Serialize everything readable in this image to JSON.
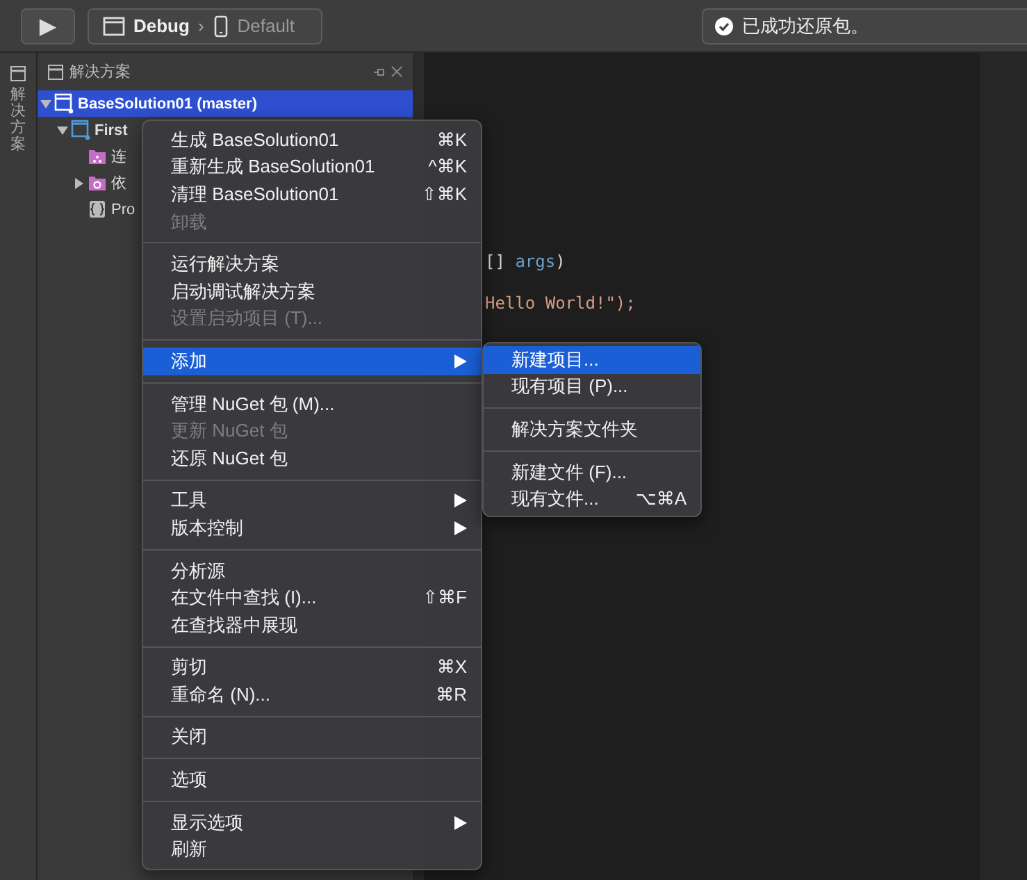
{
  "toolbar": {
    "run_button": {
      "label": "▶"
    },
    "configuration": "Debug",
    "separator": "›",
    "device": "Default",
    "status": "已成功还原包。"
  },
  "side_tab": {
    "label": "解决方案"
  },
  "solution_panel": {
    "title": "解决方案",
    "tree": [
      {
        "label": "BaseSolution01 (master)",
        "selected": true,
        "expanded": true,
        "kind": "solution",
        "children": [
          {
            "label": "First",
            "selected": false,
            "expanded": true,
            "kind": "project",
            "children": [
              {
                "label": "连",
                "selected": false,
                "kind": "folder"
              },
              {
                "label": "依",
                "selected": false,
                "expanded": false,
                "kind": "package-folder"
              },
              {
                "label": "Pro",
                "selected": false,
                "kind": "code-file"
              }
            ]
          }
        ]
      }
    ]
  },
  "editor": {
    "code_lines": [
      {
        "text": "[] ",
        "arg": "args",
        "tail": ")"
      },
      {
        "text": "Hello World!\");"
      }
    ]
  },
  "context_menu": {
    "items": [
      {
        "kind": "item",
        "label": "生成 BaseSolution01",
        "shortcut": "⌘K",
        "disabled": false,
        "selected": false,
        "submenu": false
      },
      {
        "kind": "item",
        "label": "重新生成 BaseSolution01",
        "shortcut": "^⌘K",
        "disabled": false,
        "selected": false,
        "submenu": false
      },
      {
        "kind": "item",
        "label": "清理 BaseSolution01",
        "shortcut": "⇧⌘K",
        "disabled": false,
        "selected": false,
        "submenu": false
      },
      {
        "kind": "item",
        "label": "卸载",
        "disabled": true,
        "selected": false,
        "submenu": false
      },
      {
        "kind": "separator"
      },
      {
        "kind": "item",
        "label": "运行解决方案",
        "disabled": false,
        "selected": false,
        "submenu": false
      },
      {
        "kind": "item",
        "label": "启动调试解决方案",
        "disabled": false,
        "selected": false,
        "submenu": false
      },
      {
        "kind": "item",
        "label": "设置启动项目 (T)...",
        "disabled": true,
        "selected": false,
        "submenu": false
      },
      {
        "kind": "separator"
      },
      {
        "kind": "item",
        "label": "添加",
        "disabled": false,
        "selected": true,
        "submenu": true
      },
      {
        "kind": "separator"
      },
      {
        "kind": "item",
        "label": "管理 NuGet 包 (M)...",
        "disabled": false,
        "selected": false,
        "submenu": false
      },
      {
        "kind": "item",
        "label": "更新 NuGet 包",
        "disabled": true,
        "selected": false,
        "submenu": false
      },
      {
        "kind": "item",
        "label": "还原 NuGet 包",
        "disabled": false,
        "selected": false,
        "submenu": false
      },
      {
        "kind": "separator"
      },
      {
        "kind": "item",
        "label": "工具",
        "disabled": false,
        "selected": false,
        "submenu": true
      },
      {
        "kind": "item",
        "label": "版本控制",
        "disabled": false,
        "selected": false,
        "submenu": true
      },
      {
        "kind": "separator"
      },
      {
        "kind": "item",
        "label": "分析源",
        "disabled": false,
        "selected": false,
        "submenu": false
      },
      {
        "kind": "item",
        "label": "在文件中查找 (I)...",
        "shortcut": "⇧⌘F",
        "disabled": false,
        "selected": false,
        "submenu": false
      },
      {
        "kind": "item",
        "label": "在查找器中展现",
        "disabled": false,
        "selected": false,
        "submenu": false
      },
      {
        "kind": "separator"
      },
      {
        "kind": "item",
        "label": "剪切",
        "shortcut": "⌘X",
        "disabled": false,
        "selected": false,
        "submenu": false
      },
      {
        "kind": "item",
        "label": "重命名 (N)...",
        "shortcut": "⌘R",
        "disabled": false,
        "selected": false,
        "submenu": false
      },
      {
        "kind": "separator"
      },
      {
        "kind": "item",
        "label": "关闭",
        "disabled": false,
        "selected": false,
        "submenu": false
      },
      {
        "kind": "separator"
      },
      {
        "kind": "item",
        "label": "选项",
        "disabled": false,
        "selected": false,
        "submenu": false
      },
      {
        "kind": "separator"
      },
      {
        "kind": "item",
        "label": "显示选项",
        "disabled": false,
        "selected": false,
        "submenu": true
      },
      {
        "kind": "item",
        "label": "刷新",
        "disabled": false,
        "selected": false,
        "submenu": false
      }
    ]
  },
  "submenu": {
    "items": [
      {
        "kind": "item",
        "label": "新建项目...",
        "selected": true
      },
      {
        "kind": "item",
        "label": "现有项目 (P)...",
        "selected": false
      },
      {
        "kind": "separator"
      },
      {
        "kind": "item",
        "label": "解决方案文件夹",
        "selected": false
      },
      {
        "kind": "separator"
      },
      {
        "kind": "item",
        "label": "新建文件 (F)...",
        "selected": false
      },
      {
        "kind": "item",
        "label": "现有文件...",
        "shortcut": "⌥⌘A",
        "selected": false
      }
    ]
  }
}
